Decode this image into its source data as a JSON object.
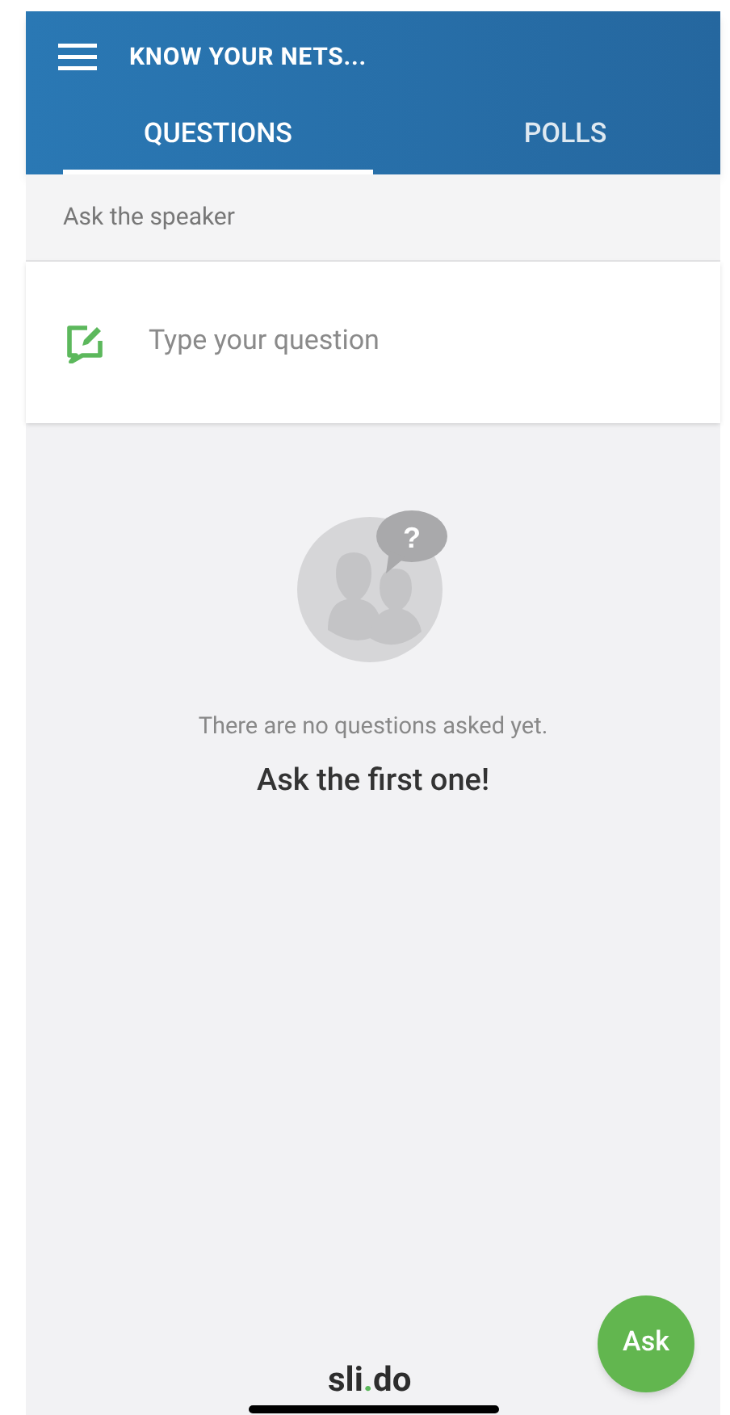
{
  "header": {
    "title": "KNOW YOUR NETS..."
  },
  "tabs": [
    {
      "label": "QUESTIONS",
      "selected": true
    },
    {
      "label": "POLLS",
      "selected": false
    }
  ],
  "section_label": "Ask the speaker",
  "question_field": {
    "placeholder": "Type your question"
  },
  "empty_state": {
    "bubble_mark": "?",
    "message": "There are no questions asked yet.",
    "call_to_action": "Ask the first one!"
  },
  "ask_button": "Ask",
  "logo": {
    "before": "sli",
    "dot": ".",
    "after": "do"
  }
}
